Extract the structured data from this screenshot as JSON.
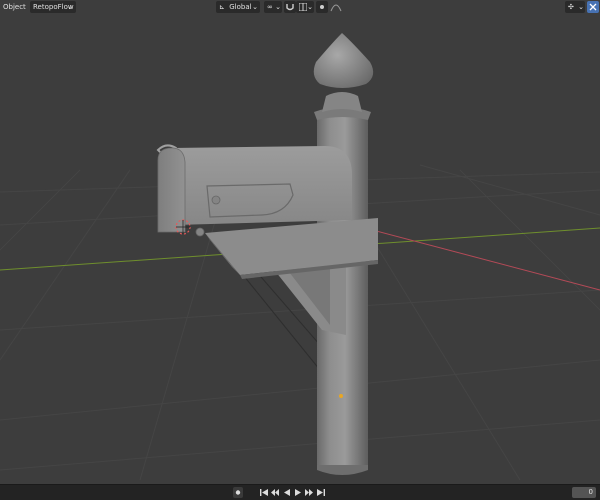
{
  "header": {
    "mode_label": "Object",
    "addon_menu_label": "RetopoFlow",
    "transform_orientation": "Global"
  },
  "timeline": {
    "current_frame": "0"
  },
  "icons": [
    "axis-orientation-icon",
    "link-icon",
    "snap-magnet-icon",
    "snap-increment-icon",
    "proportional-dot-icon",
    "falloff-curve-icon",
    "gizmo-icon",
    "view-toggle-icon",
    "record-icon",
    "jump-start-icon",
    "keyframe-prev-icon",
    "play-reverse-icon",
    "play-icon",
    "keyframe-next-icon",
    "jump-end-icon"
  ],
  "colors": {
    "viewport_bg": "#3d3d3d",
    "x_axis": "#c84e5c",
    "y_axis": "#7ea12c",
    "header_btn": "#2a2a2a",
    "active_btn": "#4772b3"
  }
}
